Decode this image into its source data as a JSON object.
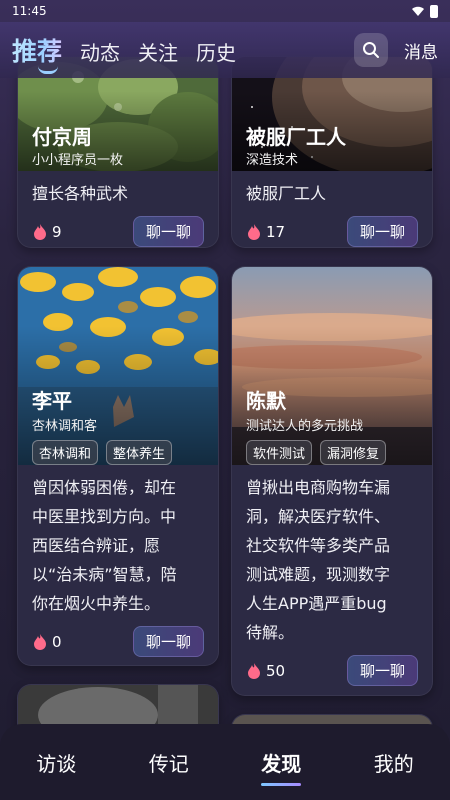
{
  "status": {
    "time": "11:45"
  },
  "top_nav": {
    "tabs": [
      "推荐",
      "动态",
      "关注",
      "历史"
    ],
    "active_tab": "推荐",
    "messages_label": "消息"
  },
  "cards": [
    {
      "name": "付京周",
      "tagline": "小小程序员一枚",
      "description": "擅长各种武术",
      "likes": "9",
      "chat_label": "聊一聊"
    },
    {
      "name": "被服厂工人",
      "tagline": "深造技术",
      "description": "被服厂工人",
      "likes": "17",
      "chat_label": "聊一聊"
    },
    {
      "name": "李平",
      "tagline": "杏林调和客",
      "chips": [
        "杏林调和",
        "整体养生"
      ],
      "description_lines": [
        "曾因体弱困倦，却在",
        "中医里找到方向。中",
        "西医结合辨证，愿",
        "以“治未病”智慧，陪",
        "你在烟火中养生。"
      ],
      "likes": "0",
      "chat_label": "聊一聊"
    },
    {
      "name": "陈默",
      "tagline": "测试达人的多元挑战",
      "chips": [
        "软件测试",
        "漏洞修复"
      ],
      "description_lines": [
        "曾揪出电商购物车漏",
        "洞，解决医疗软件、",
        "社交软件等多类产品",
        "测试难题，现测数字",
        "人生APP遇严重bug",
        "待解。"
      ],
      "likes": "50",
      "chat_label": "聊一聊"
    }
  ],
  "bottom_nav": {
    "items": [
      "访谈",
      "传记",
      "发现",
      "我的"
    ],
    "active": "发现"
  },
  "colors": {
    "accent": "#9ad0ff",
    "flame": "#ff6b8a",
    "background": "#2a2440"
  }
}
